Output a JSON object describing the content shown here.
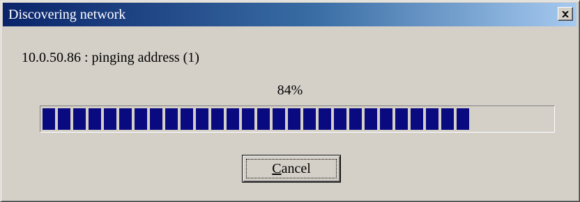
{
  "window": {
    "title": "Discovering network",
    "close_icon": "close-icon"
  },
  "status": {
    "text": "10.0.50.86 : pinging address (1)"
  },
  "progress": {
    "percent_label": "84%",
    "value": 0.84,
    "fill_color": "#0a0a80"
  },
  "buttons": {
    "cancel_mnemonic": "C",
    "cancel_rest": "ancel"
  },
  "colors": {
    "title_start": "#0a246a",
    "title_end": "#a6caf0",
    "face": "#d4d0c8"
  }
}
